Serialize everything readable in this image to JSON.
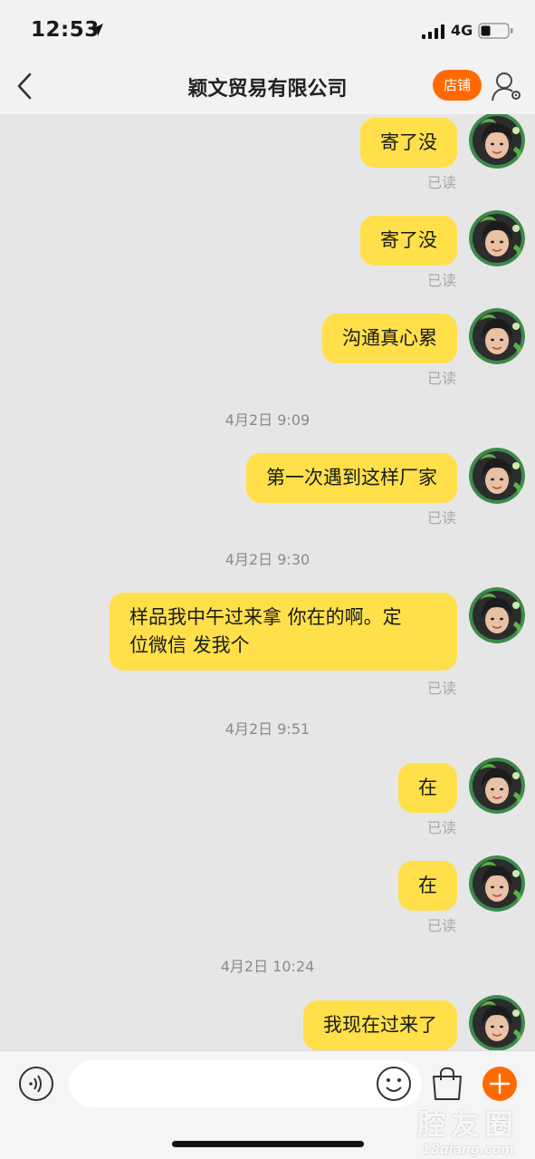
{
  "status_bar": {
    "time": "12:53",
    "network": "4G",
    "icons": [
      "location-arrow-icon",
      "signal-icon",
      "battery-icon"
    ]
  },
  "nav": {
    "title": "颖文贸易有限公司",
    "shop_label": "店铺",
    "icons": [
      "back-chevron-icon",
      "person-settings-icon"
    ]
  },
  "messages": [
    {
      "text": "寄了没",
      "read": "已读"
    },
    {
      "text": "寄了没",
      "read": "已读"
    },
    {
      "text": "沟通真心累",
      "read": "已读"
    },
    {
      "timestamp": "4月2日 9:09"
    },
    {
      "text": "第一次遇到这样厂家",
      "read": "已读"
    },
    {
      "timestamp": "4月2日 9:30"
    },
    {
      "text": "样品我中午过来拿 你在的啊。定\n位微信 发我个",
      "read": "已读"
    },
    {
      "timestamp": "4月2日 9:51"
    },
    {
      "text": "在",
      "read": "已读"
    },
    {
      "text": "在",
      "read": "已读"
    },
    {
      "timestamp": "4月2日 10:24"
    },
    {
      "text": "我现在过来了"
    }
  ],
  "input_bar": {
    "placeholder": "",
    "icons": [
      "voice-icon",
      "emoji-icon",
      "shopping-bag-icon",
      "plus-icon"
    ]
  },
  "watermark": {
    "main": "腔友圈",
    "sub": "18qiang.com"
  },
  "colors": {
    "bubble": "#ffe04a",
    "accent": "#ff6a00",
    "background": "#e6e6e6"
  }
}
